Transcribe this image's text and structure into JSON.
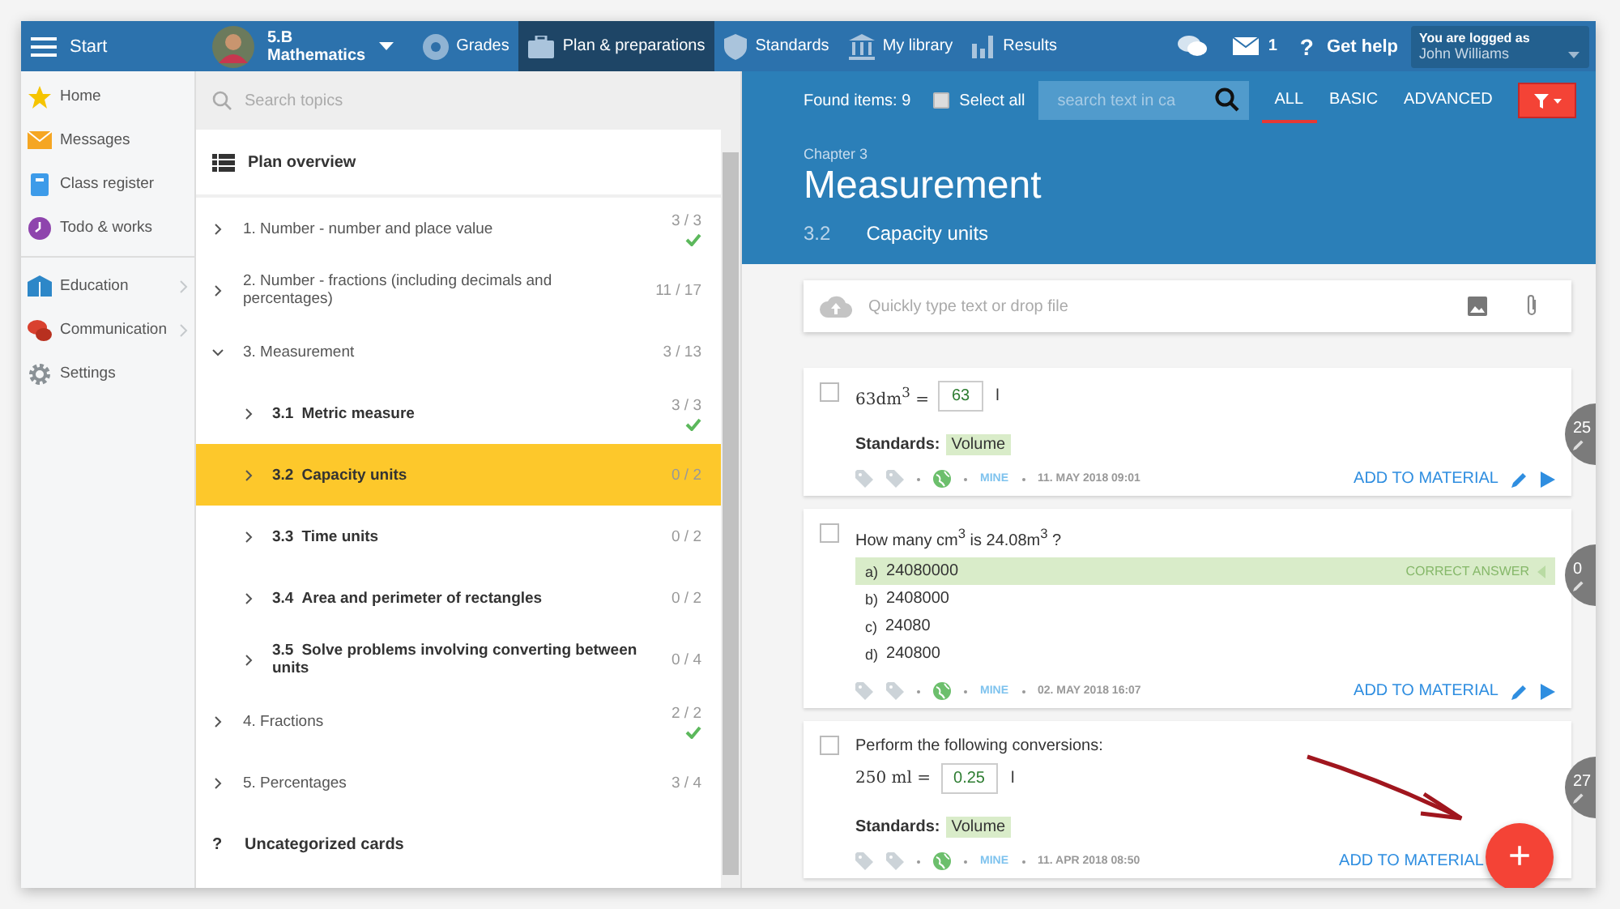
{
  "top_bar": {
    "menu_label": "Start",
    "class_name": "5.B",
    "class_subject": "Mathematics",
    "nav": [
      {
        "label": "Grades",
        "selected": false
      },
      {
        "label": "Plan & preparations",
        "selected": true
      },
      {
        "label": "Standards",
        "selected": false
      },
      {
        "label": "My library",
        "selected": false
      },
      {
        "label": "Results",
        "selected": false
      }
    ],
    "message_count": "1",
    "help_icon": "?",
    "help_label": "Get help",
    "user_caption": "You are logged as",
    "user_name": "John Williams"
  },
  "sidebar": {
    "groups": [
      [
        {
          "label": "Home",
          "submenu": false
        },
        {
          "label": "Messages",
          "submenu": false
        },
        {
          "label": "Class register",
          "submenu": false
        },
        {
          "label": "Todo & works",
          "submenu": false
        }
      ],
      [
        {
          "label": "Education",
          "submenu": true
        },
        {
          "label": "Communication",
          "submenu": true
        },
        {
          "label": "Settings",
          "submenu": false
        }
      ]
    ]
  },
  "topics": {
    "search_placeholder": "Search topics",
    "overview": "Plan overview",
    "items": [
      {
        "label": "1. Number - number and place value",
        "count": "3 / 3",
        "done": true,
        "selected": false,
        "expanded": false
      },
      {
        "label": "2. Number - fractions (including decimals and percentages)",
        "count": "11 / 17",
        "done": false,
        "selected": false,
        "expanded": false
      },
      {
        "label": "3. Measurement",
        "count": "3 / 13",
        "done": false,
        "selected": false,
        "expanded": true,
        "children": [
          {
            "number": "3.1",
            "label": "Metric measure",
            "count": "3 / 3",
            "done": true,
            "selected": false,
            "expanded": false
          },
          {
            "number": "3.2",
            "label": "Capacity units",
            "count": "0 / 2",
            "done": false,
            "selected": true,
            "expanded": false
          },
          {
            "number": "3.3",
            "label": "Time units",
            "count": "0 / 2",
            "done": false,
            "selected": false,
            "expanded": false
          },
          {
            "number": "3.4",
            "label": "Area and perimeter of rectangles",
            "count": "0 / 2",
            "done": false,
            "selected": false,
            "expanded": false
          },
          {
            "number": "3.5",
            "label": "Solve problems involving converting between units",
            "count": "0 / 4",
            "done": false,
            "selected": false,
            "expanded": false
          }
        ]
      },
      {
        "label": "4. Fractions",
        "count": "2 / 2",
        "done": true,
        "selected": false,
        "expanded": false
      },
      {
        "label": "5. Percentages",
        "count": "3 / 4",
        "done": false,
        "selected": false,
        "expanded": false
      }
    ],
    "uncategorized_icon": "?",
    "uncategorized": "Uncategorized cards"
  },
  "toolbar": {
    "found": "Found items: 9",
    "select_all": {
      "label": "Select all",
      "checked": false
    },
    "search_placeholder": "search text in ca",
    "filters": [
      {
        "label": "ALL",
        "selected": true
      },
      {
        "label": "BASIC",
        "selected": false
      },
      {
        "label": "ADVANCED",
        "selected": false
      }
    ]
  },
  "header": {
    "chapter": "Chapter 3",
    "title": "Measurement",
    "section_number": "3.2",
    "section_title": "Capacity units"
  },
  "quick_input": {
    "placeholder": "Quickly type text or drop file"
  },
  "cards": [
    {
      "kind": "fill",
      "checked": false,
      "prefix": "63dm$^{3}$ =",
      "answer": "63",
      "unit": "l",
      "standards_label": "Standards:",
      "standard": "Volume",
      "owner": "MINE",
      "date": "11. MAY 2018 09:01",
      "action": "ADD TO MATERIAL",
      "tools": true,
      "badge": "25"
    },
    {
      "kind": "choice",
      "checked": false,
      "question": "How many cm$^{3}$ is 24.08m$^{3}$ ?",
      "correct_label": "CORRECT ANSWER",
      "options": [
        {
          "letter": "a)",
          "text": "24080000",
          "correct": true
        },
        {
          "letter": "b)",
          "text": "2408000",
          "correct": false
        },
        {
          "letter": "c)",
          "text": "24080",
          "correct": false
        },
        {
          "letter": "d)",
          "text": "240800",
          "correct": false
        }
      ],
      "owner": "MINE",
      "date": "02. MAY 2018 16:07",
      "action": "ADD TO MATERIAL",
      "tools": true,
      "badge": "0"
    },
    {
      "kind": "fill",
      "checked": false,
      "question": "Perform the following conversions:",
      "prefix": "250 ml =",
      "answer": "0.25",
      "unit": "l",
      "standards_label": "Standards:",
      "standard": "Volume",
      "owner": "MINE",
      "date": "11. APR 2018 08:50",
      "action": "ADD TO MATERIAL",
      "tools": false,
      "badge": "27"
    }
  ],
  "fab": {
    "icon": "+"
  }
}
